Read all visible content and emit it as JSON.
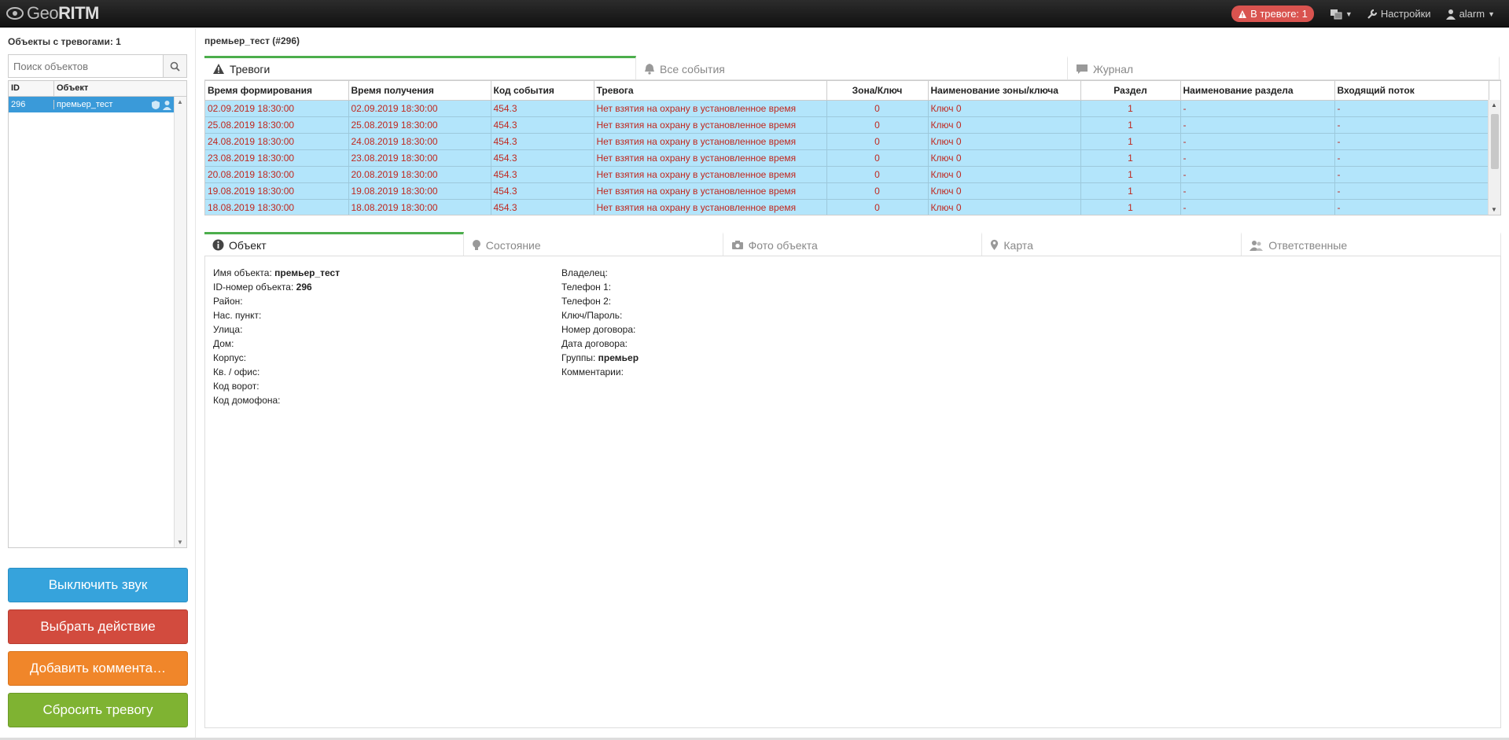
{
  "app": {
    "logo_left": "Geo",
    "logo_right": "RITM",
    "alarm_badge": "В тревоге: 1",
    "settings": "Настройки",
    "user": "alarm"
  },
  "sidebar": {
    "title": "Объекты с тревогами: 1",
    "search_placeholder": "Поиск объектов",
    "columns": [
      "ID",
      "Объект"
    ],
    "rows": [
      {
        "id": "296",
        "name": "премьер_тест"
      }
    ]
  },
  "actions": {
    "mute": "Выключить звук",
    "choose_action": "Выбрать действие",
    "add_comment": "Добавить коммента…",
    "reset_alarm": "Сбросить тревогу"
  },
  "main": {
    "title": "премьер_тест (#296)",
    "tabs": [
      "Тревоги",
      "Все события",
      "Журнал"
    ],
    "columns": [
      "Время формирования",
      "Время получения",
      "Код события",
      "Тревога",
      "Зона/Ключ",
      "Наименование зоны/ключа",
      "Раздел",
      "Наименование раздела",
      "Входящий поток"
    ],
    "rows": [
      [
        "02.09.2019 18:30:00",
        "02.09.2019 18:30:00",
        "454.3",
        "Нет взятия на охрану в установленное время",
        "0",
        "Ключ 0",
        "1",
        "-",
        "-"
      ],
      [
        "25.08.2019 18:30:00",
        "25.08.2019 18:30:00",
        "454.3",
        "Нет взятия на охрану в установленное время",
        "0",
        "Ключ 0",
        "1",
        "-",
        "-"
      ],
      [
        "24.08.2019 18:30:00",
        "24.08.2019 18:30:00",
        "454.3",
        "Нет взятия на охрану в установленное время",
        "0",
        "Ключ 0",
        "1",
        "-",
        "-"
      ],
      [
        "23.08.2019 18:30:00",
        "23.08.2019 18:30:00",
        "454.3",
        "Нет взятия на охрану в установленное время",
        "0",
        "Ключ 0",
        "1",
        "-",
        "-"
      ],
      [
        "20.08.2019 18:30:00",
        "20.08.2019 18:30:00",
        "454.3",
        "Нет взятия на охрану в установленное время",
        "0",
        "Ключ 0",
        "1",
        "-",
        "-"
      ],
      [
        "19.08.2019 18:30:00",
        "19.08.2019 18:30:00",
        "454.3",
        "Нет взятия на охрану в установленное время",
        "0",
        "Ключ 0",
        "1",
        "-",
        "-"
      ],
      [
        "18.08.2019 18:30:00",
        "18.08.2019 18:30:00",
        "454.3",
        "Нет взятия на охрану в установленное время",
        "0",
        "Ключ 0",
        "1",
        "-",
        "-"
      ]
    ]
  },
  "details": {
    "tabs": [
      "Объект",
      "Состояние",
      "Фото объекта",
      "Карта",
      "Ответственные"
    ],
    "left": [
      {
        "label": "Имя объекта:",
        "value": "премьер_тест"
      },
      {
        "label": "ID-номер объекта:",
        "value": "296"
      },
      {
        "label": "Район:",
        "value": ""
      },
      {
        "label": "Нас. пункт:",
        "value": ""
      },
      {
        "label": "Улица:",
        "value": ""
      },
      {
        "label": "Дом:",
        "value": ""
      },
      {
        "label": "Корпус:",
        "value": ""
      },
      {
        "label": "Кв. / офис:",
        "value": ""
      },
      {
        "label": "Код ворот:",
        "value": ""
      },
      {
        "label": "Код домофона:",
        "value": ""
      }
    ],
    "right": [
      {
        "label": "Владелец:",
        "value": ""
      },
      {
        "label": "Телефон 1:",
        "value": ""
      },
      {
        "label": "Телефон 2:",
        "value": ""
      },
      {
        "label": "Ключ/Пароль:",
        "value": ""
      },
      {
        "label": "Номер договора:",
        "value": ""
      },
      {
        "label": "Дата договора:",
        "value": ""
      },
      {
        "label": "Группы:",
        "value": "премьер"
      },
      {
        "label": "Комментарии:",
        "value": ""
      }
    ]
  },
  "colors": {
    "row_highlight": "#b3e5fb",
    "alarm_text": "#c0281f",
    "tab_active": "#4cae4c",
    "selected_object": "#3a9ad9"
  }
}
